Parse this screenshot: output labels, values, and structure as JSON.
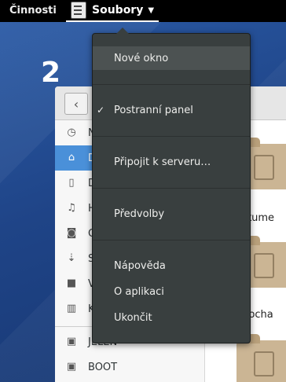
{
  "topbar": {
    "activities": "Činnosti",
    "app_name": "Soubory",
    "caret": "▼"
  },
  "desktop": {
    "workspace_number": "2"
  },
  "window": {
    "back": "‹",
    "sidebar": [
      {
        "label": "N",
        "icon": "recent-icon",
        "glyph": "◷"
      },
      {
        "label": "D",
        "icon": "home-icon",
        "glyph": "⌂",
        "selected": true
      },
      {
        "label": "D",
        "icon": "document-icon",
        "glyph": "▯"
      },
      {
        "label": "H",
        "icon": "music-icon",
        "glyph": "♫"
      },
      {
        "label": "O",
        "icon": "camera-icon",
        "glyph": "◙"
      },
      {
        "label": "S",
        "icon": "download-icon",
        "glyph": "⇣"
      },
      {
        "label": "V",
        "icon": "video-icon",
        "glyph": "■"
      },
      {
        "label": "K",
        "icon": "trash-icon",
        "glyph": "▥"
      },
      {
        "label": "JELEN",
        "icon": "drive-icon",
        "glyph": "▣"
      },
      {
        "label": "BOOT",
        "icon": "drive-icon",
        "glyph": "▣"
      }
    ],
    "folders": [
      {
        "label": "okume"
      },
      {
        "label": "Plocha"
      }
    ]
  },
  "menu": {
    "new_window": "Nové okno",
    "sidebar": "Postranní panel",
    "sidebar_check": "✓",
    "connect": "Připojit k serveru…",
    "preferences": "Předvolby",
    "help": "Nápověda",
    "about": "O aplikaci",
    "quit": "Ukončit"
  }
}
